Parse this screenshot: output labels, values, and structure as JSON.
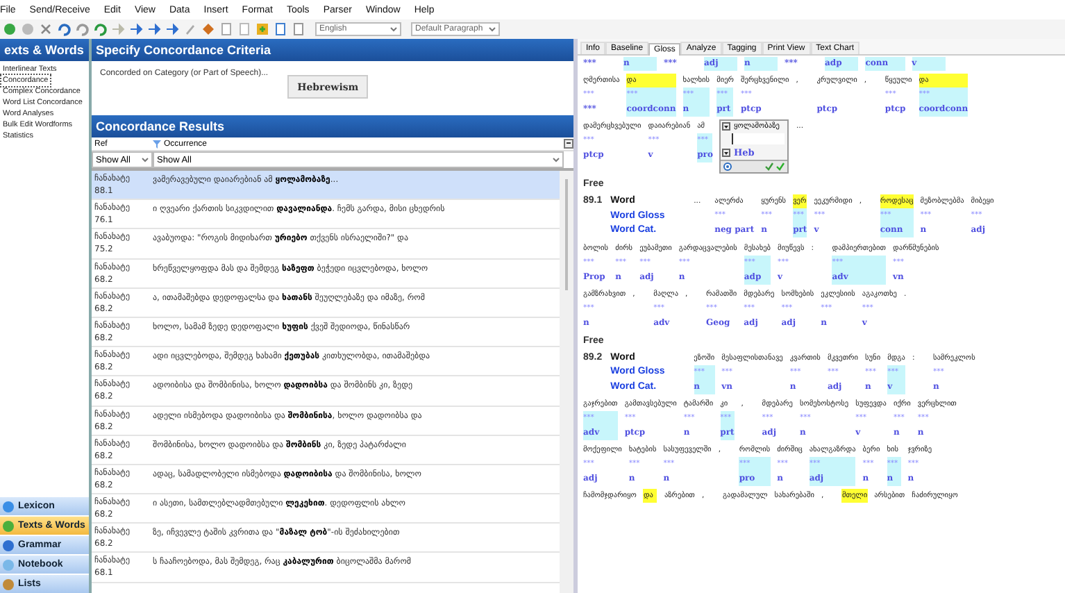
{
  "menu": [
    "File",
    "Send/Receive",
    "Edit",
    "View",
    "Data",
    "Insert",
    "Format",
    "Tools",
    "Parser",
    "Window",
    "Help"
  ],
  "toolbar": {
    "writing_system": "English",
    "style": "Default Paragraph"
  },
  "sidebar": {
    "title": "exts & Words",
    "items": [
      {
        "label": "Interlinear Texts",
        "selected": false
      },
      {
        "label": "Concordance",
        "selected": true
      },
      {
        "label": "Complex Concordance",
        "selected": false
      },
      {
        "label": "Word List Concordance",
        "selected": false
      },
      {
        "label": "Word Analyses",
        "selected": false
      },
      {
        "label": "Bulk Edit Wordforms",
        "selected": false
      },
      {
        "label": "Statistics",
        "selected": false
      }
    ],
    "areas": [
      {
        "label": "Lexicon",
        "selected": false,
        "color": "#3a8ee6"
      },
      {
        "label": "Texts & Words",
        "selected": true,
        "color": "#4caf3c"
      },
      {
        "label": "Grammar",
        "selected": false,
        "color": "#2f6fd0"
      },
      {
        "label": "Notebook",
        "selected": false,
        "color": "#7ab8e8"
      },
      {
        "label": "Lists",
        "selected": false,
        "color": "#c08a3a"
      }
    ]
  },
  "criteria": {
    "title": "Specify Concordance Criteria",
    "label": "Concorded on Category (or Part of Speech)...",
    "button": "Hebrewism"
  },
  "results": {
    "title": "Concordance Results",
    "columns": [
      "Ref",
      "Occurrence"
    ],
    "filters": [
      "Show All",
      "Show All"
    ],
    "rows": [
      {
        "ref": "ჩანახატე 88.1",
        "before": "ვამერავებული დაიარებიან ამ ",
        "keyword": "ყოლამობაზე",
        "after": "...",
        "selected": true
      },
      {
        "ref": "ჩანახატე 76.1",
        "before": "ი ღვეარი ქართის სიკვდილით ",
        "keyword": "დავალიანდა",
        "after": ". ჩემს გარდა, მისი ცხედრის",
        "selected": false
      },
      {
        "ref": "ჩანახატე 75.2",
        "before": "ავაბუოდა: \"როგის მიდიხართ ",
        "keyword": "ურიებო",
        "after": " თქვენს ისრაელიში?\" და",
        "selected": false
      },
      {
        "ref": "ჩანახატე 68.2",
        "before": "ხრეწველყოფდა მას და შემდეგ ",
        "keyword": "საზეფთ",
        "after": " ბეჭედი იცვლებოდა, ხოლო",
        "selected": false
      },
      {
        "ref": "ჩანახატე 68.2",
        "before": "ა, ითამაშებდა დედოფალსა და ",
        "keyword": "ხათანს",
        "after": " შეუღლებაზე და იმაზე, რომ",
        "selected": false
      },
      {
        "ref": "ჩანახატე 68.2",
        "before": "ხოლო, სამამ ზედე დედოფალი ",
        "keyword": "ხუფის",
        "after": " ქვეშ შედიოდა, წინასწარ",
        "selected": false
      },
      {
        "ref": "ჩანახატე 68.2",
        "before": "ადი იცვლებოდა, შემდეგ ხახამი ",
        "keyword": "ქეთუბას",
        "after": " კითხულობდა, ითამაშებდა",
        "selected": false
      },
      {
        "ref": "ჩანახატე 68.2",
        "before": "ადოიბისა და შომბინისა, ხოლო ",
        "keyword": "დადოიბსა",
        "after": " და შომბინს კი, ზედე",
        "selected": false
      },
      {
        "ref": "ჩანახატე 68.2",
        "before": "ადელი ისმებოდა დადოიბისა და ",
        "keyword": "შომბინისა",
        "after": ", ხოლო დადოიბსა და",
        "selected": false
      },
      {
        "ref": "ჩანახატე 68.2",
        "before": "შომბინისა, ხოლო დადოიბსა და ",
        "keyword": "შომბინს",
        "after": " კი, ზედე პატარძალი",
        "selected": false
      },
      {
        "ref": "ჩანახატე 68.2",
        "before": "ადაც, სამადლობელი ისმებოდა ",
        "keyword": "დადოიბისა",
        "after": " და შომბინისა, ხოლო",
        "selected": false
      },
      {
        "ref": "ჩანახატე 68.2",
        "before": "ი ასეთი, სამთლებლადმთებული ",
        "keyword": "ლეკეხით",
        "after": ". დედოფლის ახლო",
        "selected": false
      },
      {
        "ref": "ჩანახატე 68.2",
        "before": "ზე, იჩვევლე ტაშის კვრითა და \"",
        "keyword": "მაზალ ტობ",
        "after": "\"-ის შეძახილებით",
        "selected": false
      },
      {
        "ref": "ჩანახატე 68.1",
        "before": "ს ჩააჩოებოდა, მას შემდეგ, რაც ",
        "keyword": "კაბალურით",
        "after": " ბიცოლაშმა მარომ",
        "selected": false
      }
    ]
  },
  "tabs": [
    {
      "label": "Info",
      "selected": false
    },
    {
      "label": "Baseline",
      "selected": false
    },
    {
      "label": "Gloss",
      "selected": true
    },
    {
      "label": "Analyze",
      "selected": false
    },
    {
      "label": "Tagging",
      "selected": false
    },
    {
      "label": "Print View",
      "selected": false
    },
    {
      "label": "Text Chart",
      "selected": false
    }
  ],
  "fragment": {
    "cells": [
      {
        "text": "***",
        "shaded": false
      },
      {
        "text": "n",
        "shaded": true
      },
      {
        "text": "***",
        "shaded": false
      },
      {
        "text": "adj",
        "shaded": true
      },
      {
        "text": "n",
        "shaded": true
      },
      {
        "text": "***",
        "shaded": false
      },
      {
        "text": "adp",
        "shaded": true
      },
      {
        "text": "conn",
        "shaded": true
      },
      {
        "text": "v",
        "shaded": true
      }
    ],
    "lines": [
      [
        {
          "form": "ღმერთისა",
          "gloss": "***",
          "cat": "***",
          "highlighted": false,
          "shaded": false
        },
        {
          "form": "და",
          "gloss": "***",
          "cat": "coordconn",
          "highlighted": true,
          "shaded": true
        },
        {
          "form": "ხალხის",
          "gloss": "***",
          "cat": "n",
          "highlighted": false,
          "shaded": true
        },
        {
          "form": "მიერ",
          "gloss": "***",
          "cat": "prt",
          "highlighted": false,
          "shaded": true
        },
        {
          "form": "შერცხვენილი",
          "gloss": "***",
          "cat": "ptcp",
          "highlighted": false,
          "shaded": false
        },
        {
          "form": ",",
          "highlighted": false
        },
        {
          "form": "კრულვილი",
          "cat": "ptcp",
          "highlighted": false,
          "shaded": false
        },
        {
          "form": ",",
          "highlighted": false
        },
        {
          "form": "წყეული",
          "gloss": "***",
          "cat": "ptcp",
          "highlighted": false,
          "shaded": false
        },
        {
          "form": "და",
          "gloss": "***",
          "cat": "coordconn",
          "highlighted": true,
          "shaded": true
        }
      ],
      [
        {
          "form": "დამერცხვებული",
          "gloss": "***",
          "cat": "ptcp",
          "highlighted": false,
          "shaded": false
        },
        {
          "form": "დაიარებიან",
          "gloss": "***",
          "cat": "v",
          "highlighted": false,
          "shaded": false
        },
        {
          "form": "ამ",
          "gloss": "***",
          "cat": "pro",
          "highlighted": false,
          "shaded": true
        }
      ]
    ],
    "popup": {
      "form": "ყოლამობაზე",
      "cat": "Heb"
    },
    "trail": "...",
    "free": "Free"
  },
  "segments": [
    {
      "number": "89.1",
      "labels": [
        "Word",
        "Word Gloss",
        "Word Cat."
      ],
      "lines": [
        [
          {
            "form": "...",
            "highlighted": false
          },
          {
            "form": "ალერძა",
            "gloss": "***",
            "cat": "neg part",
            "highlighted": false,
            "shaded": false
          },
          {
            "form": "ყურენს",
            "gloss": "***",
            "cat": "n",
            "highlighted": false,
            "shaded": false
          },
          {
            "form": "ვერ",
            "gloss": "***",
            "cat": "prt",
            "highlighted": true,
            "shaded": true
          },
          {
            "form": "ეეკურმიდი",
            "gloss": "***",
            "cat": "v",
            "highlighted": false,
            "shaded": false
          },
          {
            "form": ",",
            "highlighted": false
          },
          {
            "form": "როდესაც",
            "gloss": "***",
            "cat": "conn",
            "highlighted": true,
            "shaded": true
          },
          {
            "form": "მეზობლებმა",
            "gloss": "***",
            "cat": "n",
            "highlighted": false,
            "shaded": false
          },
          {
            "form": "მიბეყი",
            "gloss": "***",
            "cat": "adj",
            "highlighted": false,
            "shaded": false
          }
        ],
        [
          {
            "form": "ბოლის",
            "gloss": "***",
            "cat": "Prop",
            "highlighted": false,
            "shaded": false
          },
          {
            "form": "ძირს",
            "gloss": "***",
            "cat": "n",
            "highlighted": false,
            "shaded": false
          },
          {
            "form": "ეუბამეთი",
            "gloss": "***",
            "cat": "adj",
            "highlighted": false,
            "shaded": false
          },
          {
            "form": "გარდაცვალების",
            "gloss": "***",
            "cat": "n",
            "highlighted": false,
            "shaded": false
          },
          {
            "form": "მესახებ",
            "gloss": "***",
            "cat": "adp",
            "highlighted": false,
            "shaded": true
          },
          {
            "form": "მიუწევს",
            "gloss": "***",
            "cat": "v",
            "highlighted": false,
            "shaded": false
          },
          {
            "form": ":",
            "highlighted": false
          },
          {
            "form": "დამპიერთებით",
            "gloss": "***",
            "cat": "adv",
            "highlighted": false,
            "shaded": true
          },
          {
            "form": "დარწმუნების",
            "gloss": "***",
            "cat": "vn",
            "highlighted": false,
            "shaded": false
          }
        ],
        [
          {
            "form": "გამზრახვით",
            "gloss": "***",
            "cat": "n",
            "highlighted": false,
            "shaded": false
          },
          {
            "form": ",",
            "highlighted": false
          },
          {
            "form": "მაღლა",
            "gloss": "***",
            "cat": "adv",
            "highlighted": false,
            "shaded": false
          },
          {
            "form": ",",
            "highlighted": false
          },
          {
            "form": "რამათში",
            "gloss": "***",
            "cat": "Geog",
            "highlighted": false,
            "shaded": false
          },
          {
            "form": "მდებარე",
            "gloss": "***",
            "cat": "adj",
            "highlighted": false,
            "shaded": false
          },
          {
            "form": "სომხების",
            "gloss": "***",
            "cat": "adj",
            "highlighted": false,
            "shaded": false
          },
          {
            "form": "ეკლესიის",
            "gloss": "***",
            "cat": "n",
            "highlighted": false,
            "shaded": false
          },
          {
            "form": "აგაკოთხე",
            "gloss": "***",
            "cat": "v",
            "highlighted": false,
            "shaded": false
          },
          {
            "form": ".",
            "highlighted": false
          }
        ]
      ],
      "free": "Free"
    },
    {
      "number": "89.2",
      "labels": [
        "Word",
        "Word Gloss",
        "Word Cat."
      ],
      "lines": [
        [
          {
            "form": "ეზოში",
            "gloss": "***",
            "cat": "n",
            "highlighted": false,
            "shaded": true
          },
          {
            "form": "მესაფლისთანავე",
            "gloss": "***",
            "cat": "vn",
            "highlighted": false,
            "shaded": false
          },
          {
            "form": "კვართის",
            "gloss": "***",
            "cat": "n",
            "highlighted": false,
            "shaded": false
          },
          {
            "form": "მკვეთრი",
            "gloss": "***",
            "cat": "adj",
            "highlighted": false,
            "shaded": false
          },
          {
            "form": "სუნი",
            "gloss": "***",
            "cat": "n",
            "highlighted": false,
            "shaded": false
          },
          {
            "form": "მდგა",
            "gloss": "***",
            "cat": "v",
            "highlighted": false,
            "shaded": true
          },
          {
            "form": ":",
            "highlighted": false
          },
          {
            "form": "სამრეკლოს",
            "gloss": "***",
            "cat": "n",
            "highlighted": false,
            "shaded": false
          }
        ],
        [
          {
            "form": "გაჯრებით",
            "gloss": "***",
            "cat": "adv",
            "highlighted": false,
            "shaded": true
          },
          {
            "form": "გამთავსებული",
            "gloss": "***",
            "cat": "ptcp",
            "highlighted": false,
            "shaded": false
          },
          {
            "form": "ტამარში",
            "gloss": "***",
            "cat": "n",
            "highlighted": false,
            "shaded": false
          },
          {
            "form": "კი",
            "gloss": "***",
            "cat": "prt",
            "highlighted": false,
            "shaded": true
          },
          {
            "form": ",",
            "highlighted": false
          },
          {
            "form": "მდებარე",
            "gloss": "***",
            "cat": "adj",
            "highlighted": false,
            "shaded": false
          },
          {
            "form": "სომეხოსტოსე",
            "gloss": "***",
            "cat": "n",
            "highlighted": false,
            "shaded": false
          },
          {
            "form": "სუფევდა",
            "gloss": "***",
            "cat": "v",
            "highlighted": false,
            "shaded": false
          },
          {
            "form": "იქრი",
            "gloss": "***",
            "cat": "n",
            "highlighted": false,
            "shaded": false
          },
          {
            "form": "ვერცხლით",
            "gloss": "***",
            "cat": "n",
            "highlighted": false,
            "shaded": false
          }
        ],
        [
          {
            "form": "მოქეფილი",
            "gloss": "***",
            "cat": "adj",
            "highlighted": false,
            "shaded": false
          },
          {
            "form": "ხატების",
            "gloss": "***",
            "cat": "n",
            "highlighted": false,
            "shaded": false
          },
          {
            "form": "სასუფეველში",
            "gloss": "***",
            "cat": "n",
            "highlighted": false,
            "shaded": false
          },
          {
            "form": ",",
            "highlighted": false
          },
          {
            "form": "რომლის",
            "gloss": "***",
            "cat": "pro",
            "highlighted": false,
            "shaded": true
          },
          {
            "form": "ძირშიც",
            "gloss": "***",
            "cat": "n",
            "highlighted": false,
            "shaded": false
          },
          {
            "form": "ახალგაზრდა",
            "gloss": "***",
            "cat": "adj",
            "highlighted": false,
            "shaded": true
          },
          {
            "form": "ბერი",
            "gloss": "***",
            "cat": "n",
            "highlighted": false,
            "shaded": false
          },
          {
            "form": "ხის",
            "gloss": "***",
            "cat": "n",
            "highlighted": false,
            "shaded": true
          },
          {
            "form": "ჯვრიზე",
            "gloss": "***",
            "cat": "n",
            "highlighted": false,
            "shaded": false
          }
        ],
        [
          {
            "form": "ჩამომჯდარიყო",
            "highlighted": false
          },
          {
            "form": "და",
            "highlighted": true
          },
          {
            "form": "აზრებით",
            "highlighted": false
          },
          {
            "form": ",",
            "highlighted": false
          },
          {
            "form": "გადამალულ",
            "highlighted": false
          },
          {
            "form": "სახარებაში",
            "highlighted": false
          },
          {
            "form": ",",
            "highlighted": false
          },
          {
            "form": "მთელი",
            "highlighted": true
          },
          {
            "form": "არსებით",
            "highlighted": false
          },
          {
            "form": "ჩაძირულიყო",
            "highlighted": false
          }
        ]
      ]
    }
  ]
}
